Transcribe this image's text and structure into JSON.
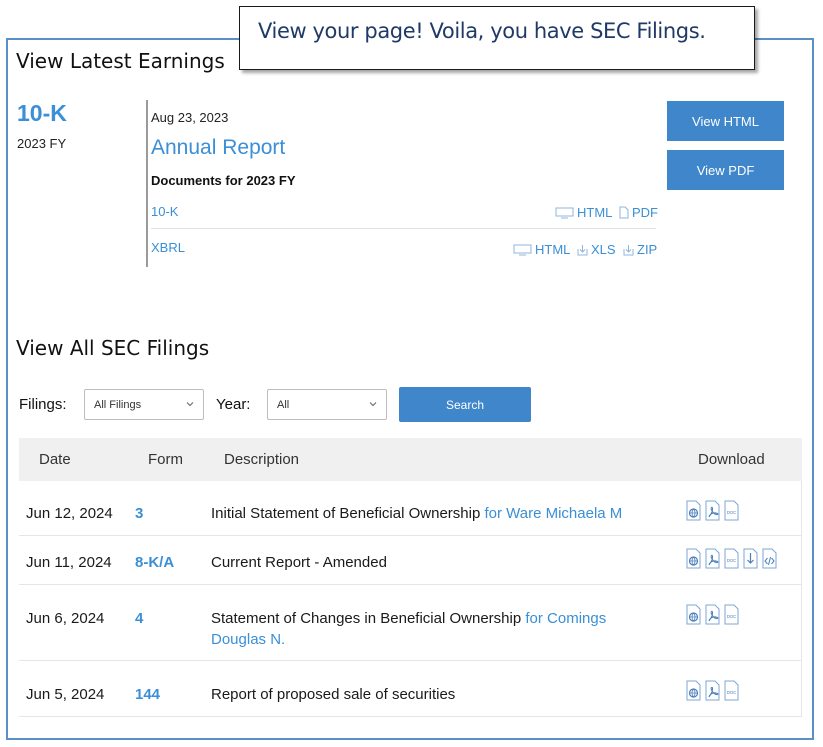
{
  "callout": {
    "text": "View your page!  Voila, you have SEC Filings."
  },
  "latest": {
    "title": "View Latest Earnings",
    "form": "10-K",
    "fy": "2023 FY",
    "date": "Aug 23, 2023",
    "report": "Annual Report",
    "docs_heading": "Documents for 2023 FY",
    "docs": [
      {
        "name": "10-K",
        "formats": [
          "HTML",
          "PDF"
        ]
      },
      {
        "name": "XBRL",
        "formats": [
          "HTML",
          "XLS",
          "ZIP"
        ]
      }
    ],
    "view_html": "View HTML",
    "view_pdf": "View PDF"
  },
  "all": {
    "title": "View All SEC Filings",
    "filings_label": "Filings:",
    "filings_value": "All Filings",
    "year_label": "Year:",
    "year_value": "All",
    "search": "Search"
  },
  "table": {
    "headers": [
      "Date",
      "Form",
      "Description",
      "Download"
    ],
    "rows": [
      {
        "date": "Jun 12, 2024",
        "form": "3",
        "desc": "Initial Statement of Beneficial Ownership",
        "who": "for Ware Michaela M",
        "downloads": [
          "html",
          "pdf",
          "doc"
        ]
      },
      {
        "date": "Jun 11, 2024",
        "form": "8-K/A",
        "desc": "Current Report - Amended",
        "who": "",
        "downloads": [
          "html",
          "pdf",
          "doc",
          "zip",
          "xbrl"
        ]
      },
      {
        "date": "Jun 6, 2024",
        "form": "4",
        "desc": "Statement of Changes in Beneficial Ownership",
        "who": "for Comings Douglas N.",
        "downloads": [
          "html",
          "pdf",
          "doc"
        ]
      },
      {
        "date": "Jun 5, 2024",
        "form": "144",
        "desc": "Report of proposed sale of securities",
        "who": "",
        "downloads": [
          "html",
          "pdf",
          "doc"
        ]
      }
    ]
  },
  "colors": {
    "accent": "#3a8fd6",
    "button": "#3f86cb",
    "frame": "#5b8fc7"
  }
}
